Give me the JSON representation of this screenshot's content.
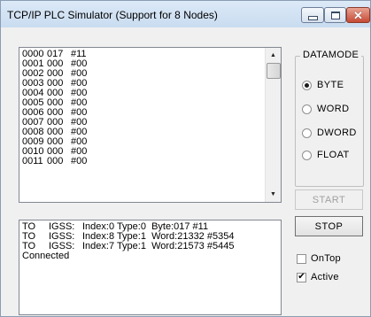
{
  "window": {
    "title": "TCP/IP PLC Simulator (Support for 8 Nodes)",
    "minimize_icon": "minimize-icon",
    "maximize_icon": "maximize-icon",
    "close_icon": "close-icon",
    "close_glyph": "✕"
  },
  "memory_list": {
    "rows": [
      {
        "addr": "0000",
        "val": "017",
        "hex": "#11"
      },
      {
        "addr": "0001",
        "val": "000",
        "hex": "#00"
      },
      {
        "addr": "0002",
        "val": "000",
        "hex": "#00"
      },
      {
        "addr": "0003",
        "val": "000",
        "hex": "#00"
      },
      {
        "addr": "0004",
        "val": "000",
        "hex": "#00"
      },
      {
        "addr": "0005",
        "val": "000",
        "hex": "#00"
      },
      {
        "addr": "0006",
        "val": "000",
        "hex": "#00"
      },
      {
        "addr": "0007",
        "val": "000",
        "hex": "#00"
      },
      {
        "addr": "0008",
        "val": "000",
        "hex": "#00"
      },
      {
        "addr": "0009",
        "val": "000",
        "hex": "#00"
      },
      {
        "addr": "0010",
        "val": "000",
        "hex": "#00"
      },
      {
        "addr": "0011",
        "val": "000",
        "hex": "#00"
      }
    ]
  },
  "log_list": {
    "rows": [
      {
        "dir": "TO",
        "target": "IGSS:",
        "text": "Index:0 Type:0  Byte:017 #11"
      },
      {
        "dir": "TO",
        "target": "IGSS:",
        "text": "Index:8 Type:1  Word:21332 #5354"
      },
      {
        "dir": "TO",
        "target": "IGSS:",
        "text": "Index:7 Type:1  Word:21573 #5445"
      },
      {
        "dir": "Connected",
        "target": "",
        "text": ""
      }
    ]
  },
  "datamode": {
    "label": "DATAMODE",
    "options": [
      {
        "label": "BYTE",
        "checked": true
      },
      {
        "label": "WORD",
        "checked": false
      },
      {
        "label": "DWORD",
        "checked": false
      },
      {
        "label": "FLOAT",
        "checked": false
      }
    ]
  },
  "buttons": {
    "start": "START",
    "stop": "STOP"
  },
  "checkboxes": {
    "ontop": {
      "label": "OnTop",
      "checked": false
    },
    "active": {
      "label": "Active",
      "checked": true,
      "mark": "✔"
    }
  }
}
